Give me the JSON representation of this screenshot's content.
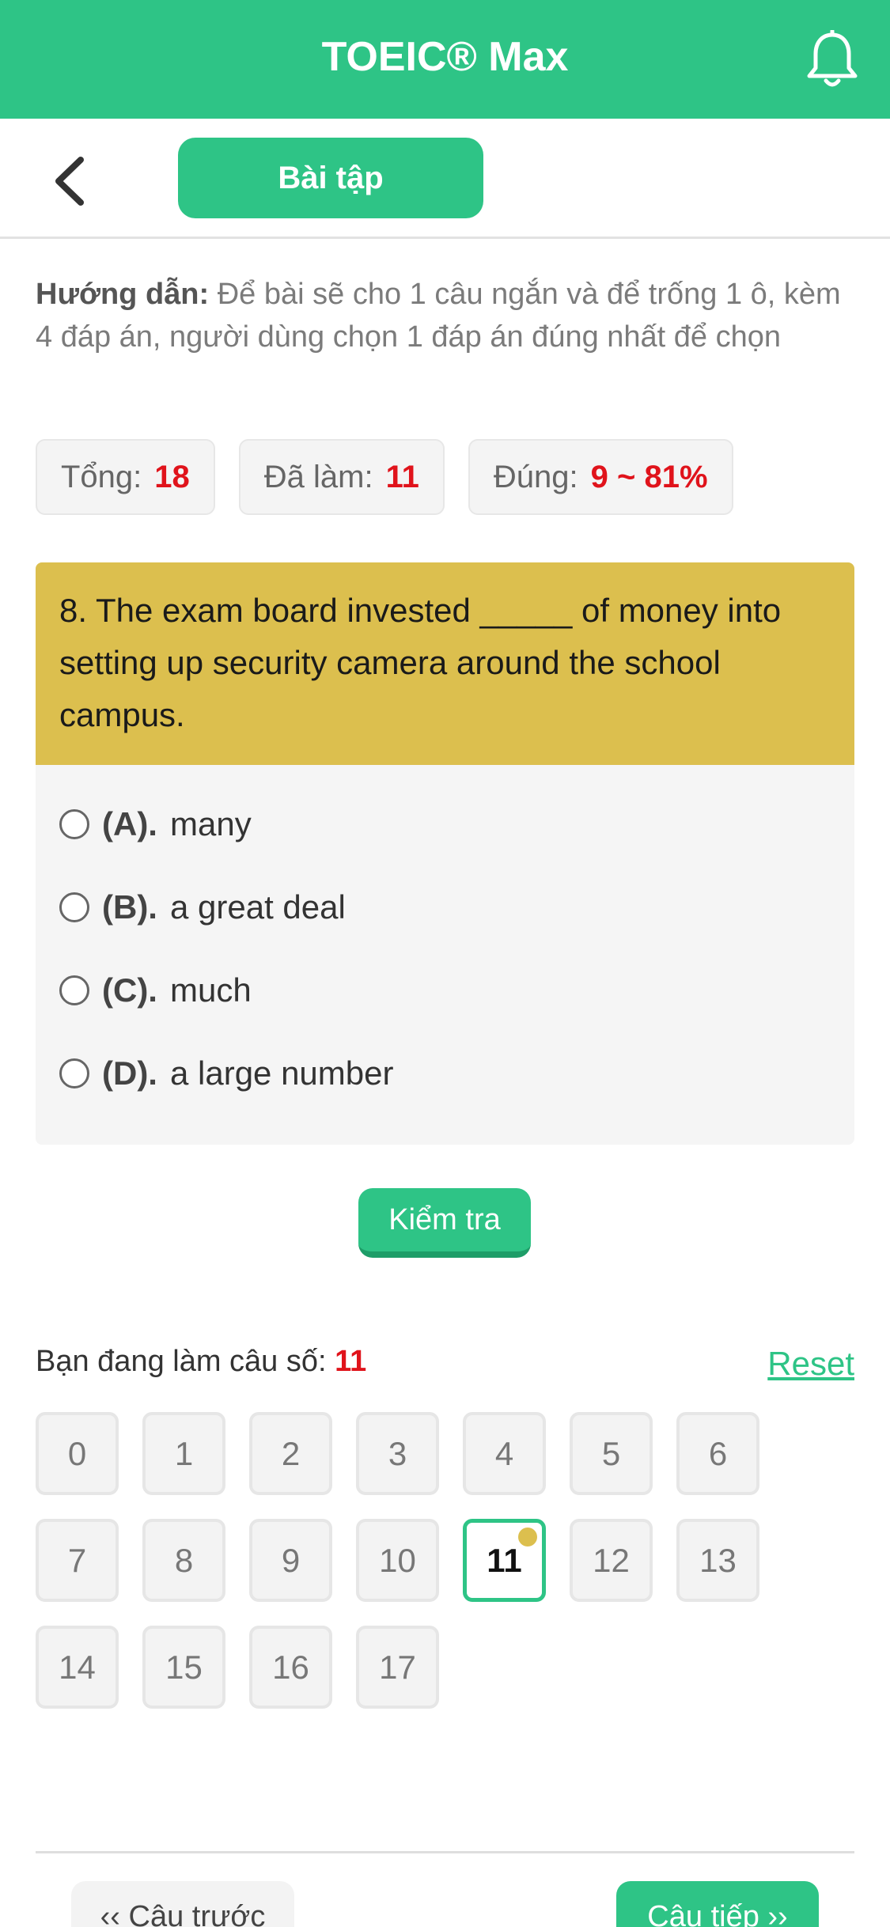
{
  "app": {
    "title": "TOEIC® Max"
  },
  "colors": {
    "primary": "#2ec486",
    "question_bg": "#dcbf4e",
    "highlight": "#e0131b"
  },
  "icons": {
    "notification": "bell-icon",
    "back": "chevron-left-icon"
  },
  "subbar": {
    "tab_label": "Bài tập"
  },
  "instructions": {
    "label": "Hướng dẫn:",
    "text": " Để bài sẽ cho 1 câu ngắn và để trống 1 ô, kèm 4 đáp án, người dùng chọn 1 đáp án đúng nhất để chọn"
  },
  "stats": {
    "total_label": "Tổng:",
    "total_value": "18",
    "done_label": "Đã làm:",
    "done_value": "11",
    "correct_label": "Đúng:",
    "correct_value": "9 ~ 81%"
  },
  "question": {
    "text": "8. The exam board invested _____ of money into setting up security camera around the school campus.",
    "options": [
      {
        "label": "(A).",
        "text": "many"
      },
      {
        "label": "(B).",
        "text": "a great deal"
      },
      {
        "label": "(C).",
        "text": "much"
      },
      {
        "label": "(D).",
        "text": "a large number"
      }
    ]
  },
  "check_button": "Kiểm tra",
  "progress": {
    "label": "Bạn đang làm câu số:",
    "current": "11",
    "reset": "Reset"
  },
  "question_numbers": [
    "0",
    "1",
    "2",
    "3",
    "4",
    "5",
    "6",
    "7",
    "8",
    "9",
    "10",
    "11",
    "12",
    "13",
    "14",
    "15",
    "16",
    "17"
  ],
  "active_question": "11",
  "nav": {
    "prev": "‹‹ Câu trước",
    "next": "Câu tiếp ››"
  }
}
